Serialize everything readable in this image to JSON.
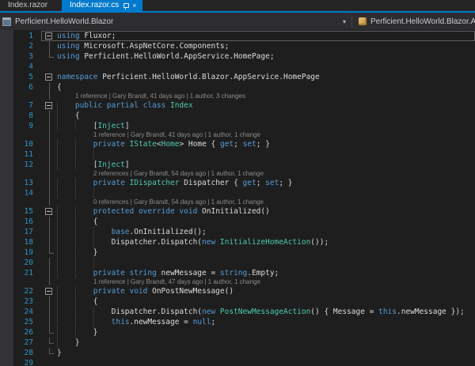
{
  "tabs": [
    {
      "label": "Index.razor",
      "active": false
    },
    {
      "label": "Index.razor.cs",
      "active": true
    }
  ],
  "tab_icons": {
    "close_glyph": "×",
    "pin": "pin-icon"
  },
  "navbar": {
    "project": "Perficient.HelloWorld.Blazor",
    "chevron_glyph": "▾",
    "type": "Perficient.HelloWorld.Blazor.Ap"
  },
  "colors": {
    "accent": "#007ACC",
    "chrome_bg": "#252526",
    "editor_bg": "#1E1E1E",
    "keyword": "#569CD6",
    "type": "#4EC9B0",
    "plain": "#DCDCDC",
    "linenum": "#2E96C9",
    "codelens": "#8C8C8C"
  },
  "editor": {
    "lines": [
      {
        "n": 1,
        "g": 0,
        "m": "box",
        "cur": true,
        "segs": [
          [
            "k",
            "using"
          ],
          [
            "w",
            " Fluxor;"
          ]
        ]
      },
      {
        "n": 2,
        "g": 0,
        "m": "line",
        "segs": [
          [
            "k",
            "using"
          ],
          [
            "w",
            " Microsoft.AspNetCore.Components;"
          ]
        ]
      },
      {
        "n": 3,
        "g": 0,
        "m": "end",
        "segs": [
          [
            "k",
            "using"
          ],
          [
            "w",
            " Perficient.HelloWorld.AppService.HomePage;"
          ]
        ]
      },
      {
        "n": 4,
        "g": 0,
        "m": "",
        "segs": []
      },
      {
        "n": 5,
        "g": 0,
        "m": "box",
        "segs": [
          [
            "k",
            "namespace"
          ],
          [
            "w",
            " Perficient.HelloWorld.Blazor.AppService.HomePage"
          ]
        ]
      },
      {
        "n": 6,
        "g": 0,
        "m": "line",
        "segs": [
          [
            "w",
            "{"
          ]
        ]
      },
      {
        "n": 7,
        "g": 1,
        "m": "box",
        "cl": "1 reference | Gary Brandt, 41 days ago | 1 author, 3 changes",
        "cli": 1,
        "segs": [
          [
            "k",
            "public partial class"
          ],
          [
            "t",
            " Index"
          ]
        ]
      },
      {
        "n": 8,
        "g": 1,
        "m": "line",
        "segs": [
          [
            "w",
            "{"
          ]
        ]
      },
      {
        "n": 9,
        "g": 2,
        "m": "line",
        "segs": [
          [
            "w",
            "["
          ],
          [
            "t",
            "Inject"
          ],
          [
            "w",
            "]"
          ]
        ]
      },
      {
        "n": 10,
        "g": 2,
        "m": "line",
        "cl": "1 reference | Gary Brandt, 41 days ago | 1 author, 1 change",
        "cli": 2,
        "segs": [
          [
            "k",
            "private"
          ],
          [
            "w",
            " "
          ],
          [
            "t",
            "IState"
          ],
          [
            "w",
            "<"
          ],
          [
            "t",
            "Home"
          ],
          [
            "w",
            "> Home { "
          ],
          [
            "k",
            "get"
          ],
          [
            "w",
            "; "
          ],
          [
            "k",
            "set"
          ],
          [
            "w",
            "; }"
          ]
        ]
      },
      {
        "n": 11,
        "g": 2,
        "gz": true,
        "m": "line",
        "segs": []
      },
      {
        "n": 12,
        "g": 2,
        "m": "line",
        "segs": [
          [
            "w",
            "["
          ],
          [
            "t",
            "Inject"
          ],
          [
            "w",
            "]"
          ]
        ]
      },
      {
        "n": 13,
        "g": 2,
        "m": "line",
        "cl": "2 references | Gary Brandt, 54 days ago | 1 author, 1 change",
        "cli": 2,
        "segs": [
          [
            "k",
            "private"
          ],
          [
            "w",
            " "
          ],
          [
            "t",
            "IDispatcher"
          ],
          [
            "w",
            " Dispatcher { "
          ],
          [
            "k",
            "get"
          ],
          [
            "w",
            "; "
          ],
          [
            "k",
            "set"
          ],
          [
            "w",
            "; }"
          ]
        ]
      },
      {
        "n": 14,
        "g": 2,
        "gz": true,
        "m": "line",
        "segs": []
      },
      {
        "n": 15,
        "g": 2,
        "m": "box",
        "cl": "0 references | Gary Brandt, 54 days ago | 1 author, 1 change",
        "cli": 2,
        "segs": [
          [
            "k",
            "protected override void"
          ],
          [
            "w",
            " OnInitialized()"
          ]
        ]
      },
      {
        "n": 16,
        "g": 2,
        "m": "line",
        "segs": [
          [
            "w",
            "{"
          ]
        ]
      },
      {
        "n": 17,
        "g": 3,
        "m": "line",
        "segs": [
          [
            "k",
            "base"
          ],
          [
            "w",
            ".OnInitialized();"
          ]
        ]
      },
      {
        "n": 18,
        "g": 3,
        "m": "line",
        "segs": [
          [
            "w",
            "Dispatcher.Dispatch("
          ],
          [
            "k",
            "new"
          ],
          [
            "t",
            " InitializeHomeAction"
          ],
          [
            "w",
            "());"
          ]
        ]
      },
      {
        "n": 19,
        "g": 2,
        "m": "end",
        "segs": [
          [
            "w",
            "}"
          ]
        ]
      },
      {
        "n": 20,
        "g": 2,
        "gz": true,
        "m": "line",
        "segs": []
      },
      {
        "n": 21,
        "g": 2,
        "m": "line",
        "segs": [
          [
            "k",
            "private string"
          ],
          [
            "w",
            " newMessage = "
          ],
          [
            "k",
            "string"
          ],
          [
            "w",
            ".Empty;"
          ]
        ]
      },
      {
        "n": 22,
        "g": 2,
        "m": "box",
        "cl": "1 reference | Gary Brandt, 47 days ago | 1 author, 1 change",
        "cli": 2,
        "segs": [
          [
            "k",
            "private void"
          ],
          [
            "w",
            " OnPostNewMessage()"
          ]
        ]
      },
      {
        "n": 23,
        "g": 2,
        "m": "line",
        "segs": [
          [
            "w",
            "{"
          ]
        ]
      },
      {
        "n": 24,
        "g": 3,
        "m": "line",
        "segs": [
          [
            "w",
            "Dispatcher.Dispatch("
          ],
          [
            "k",
            "new"
          ],
          [
            "t",
            " PostNewMessageAction"
          ],
          [
            "w",
            "() { Message = "
          ],
          [
            "k",
            "this"
          ],
          [
            "w",
            ".newMessage });"
          ]
        ]
      },
      {
        "n": 25,
        "g": 3,
        "m": "line",
        "segs": [
          [
            "k",
            "this"
          ],
          [
            "w",
            ".newMessage = "
          ],
          [
            "k",
            "null"
          ],
          [
            "w",
            ";"
          ]
        ]
      },
      {
        "n": 26,
        "g": 2,
        "m": "end",
        "segs": [
          [
            "w",
            "}"
          ]
        ]
      },
      {
        "n": 27,
        "g": 1,
        "m": "end",
        "segs": [
          [
            "w",
            "}"
          ]
        ]
      },
      {
        "n": 28,
        "g": 0,
        "m": "end",
        "segs": [
          [
            "w",
            "}"
          ]
        ]
      },
      {
        "n": 29,
        "g": 0,
        "m": "",
        "segs": []
      }
    ]
  }
}
